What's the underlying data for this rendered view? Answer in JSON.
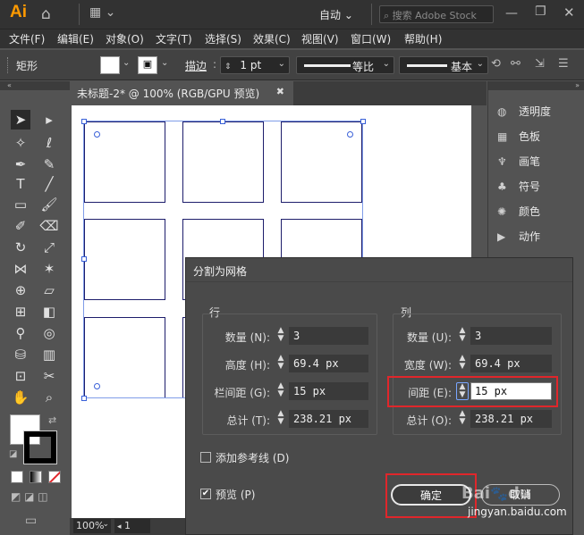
{
  "app": {
    "logo": "Ai",
    "workspace": "自动",
    "stock_search_placeholder": "搜索 Adobe Stock"
  },
  "menus": [
    "文件(F)",
    "编辑(E)",
    "对象(O)",
    "文字(T)",
    "选择(S)",
    "效果(C)",
    "视图(V)",
    "窗口(W)",
    "帮助(H)"
  ],
  "control": {
    "tool_name": "矩形",
    "stroke_label": "描边",
    "stroke_value": "1 pt",
    "profile_label": "等比",
    "brush_label": "基本"
  },
  "document": {
    "tab_title": "未标题-2* @ 100% (RGB/GPU 预览)",
    "zoom": "100%",
    "page": "1"
  },
  "panels": [
    "透明度",
    "色板",
    "画笔",
    "符号",
    "颜色",
    "动作"
  ],
  "dialog": {
    "title": "分割为网格",
    "rows": {
      "heading": "行",
      "count_label": "数量 (N):",
      "count": "3",
      "height_label": "高度 (H):",
      "height": "69.4 px",
      "gutter_label": "栏间距 (G):",
      "gutter": "15 px",
      "total_label": "总计 (T):",
      "total": "238.21 px"
    },
    "cols": {
      "heading": "列",
      "count_label": "数量 (U):",
      "count": "3",
      "width_label": "宽度 (W):",
      "width": "69.4 px",
      "gutter_label": "间距 (E):",
      "gutter": "15 px",
      "total_label": "总计 (O):",
      "total": "238.21 px"
    },
    "add_guides": "添加参考线 (D)",
    "preview": "预览 (P)",
    "ok": "确定",
    "cancel": "取消"
  },
  "watermark": "jingyan.baidu.com",
  "colors": {
    "accent_red": "#e0262b",
    "selection_blue": "#3960d8",
    "logo_orange": "#ff9a00"
  }
}
